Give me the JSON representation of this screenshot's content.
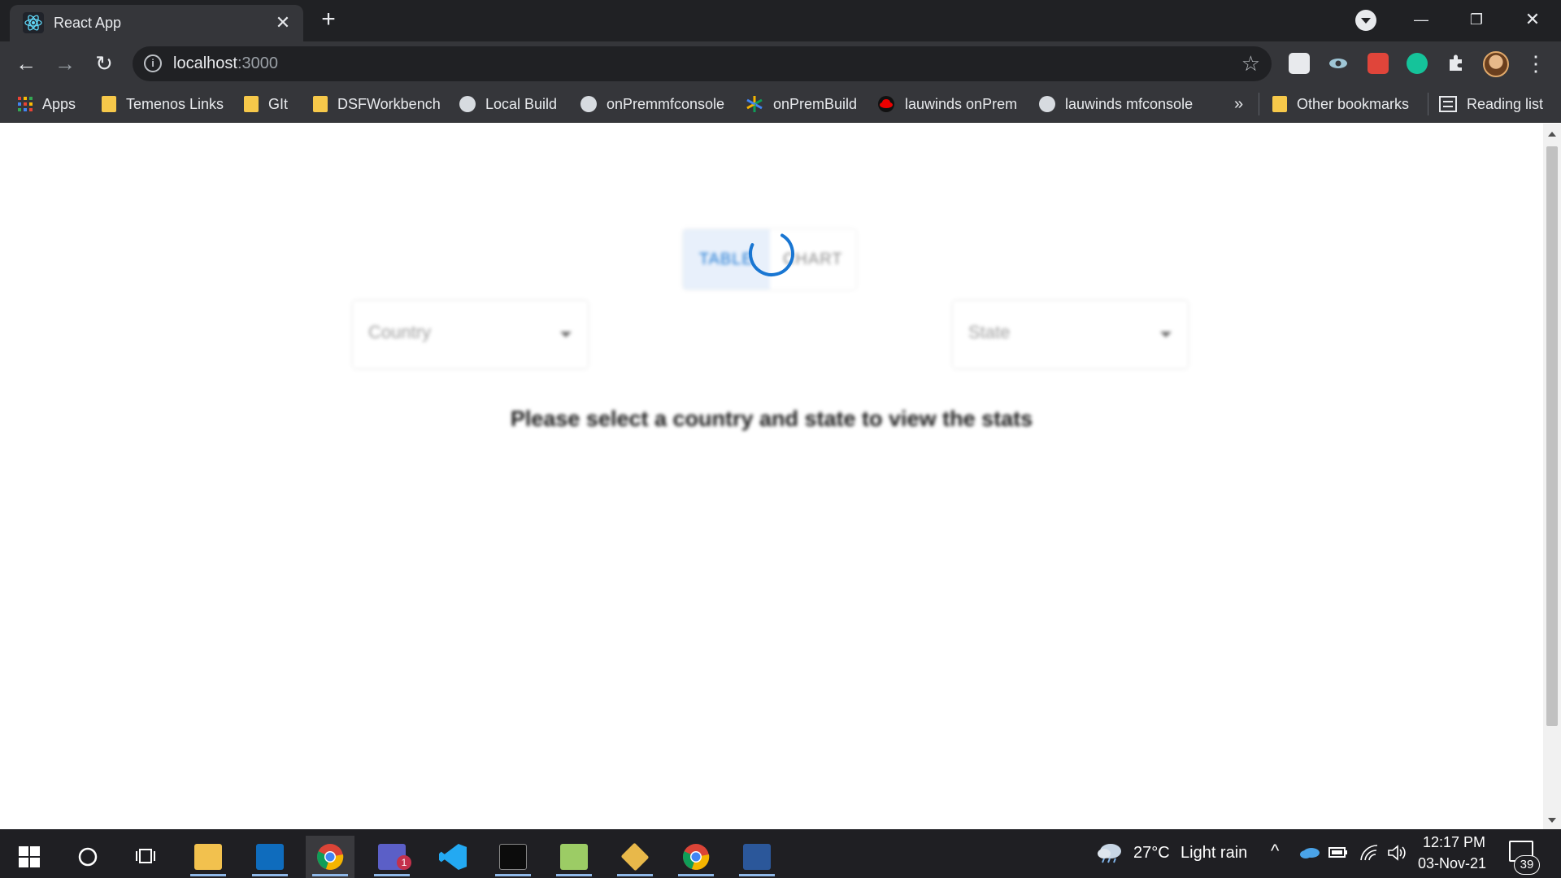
{
  "browser": {
    "tab": {
      "title": "React App"
    },
    "address": {
      "host": "localhost",
      "port": ":3000"
    },
    "bookmarks": [
      {
        "label": "Apps",
        "icon": "apps-grid-icon"
      },
      {
        "label": "Temenos Links",
        "icon": "folder-icon"
      },
      {
        "label": "GIt",
        "icon": "folder-icon"
      },
      {
        "label": "DSFWorkbench",
        "icon": "folder-icon"
      },
      {
        "label": "Local Build",
        "icon": "globe-icon"
      },
      {
        "label": "onPremmfconsole",
        "icon": "globe-icon"
      },
      {
        "label": "onPremBuild",
        "icon": "pinwheel-icon"
      },
      {
        "label": "lauwinds onPrem",
        "icon": "redhat-icon"
      },
      {
        "label": "lauwinds mfconsole",
        "icon": "globe-icon"
      }
    ],
    "bookmarks_overflow": "»",
    "other_bookmarks": "Other bookmarks",
    "reading_list": "Reading list"
  },
  "app": {
    "toggle": {
      "table_label": "TABLE",
      "chart_label": "CHART"
    },
    "country_select": {
      "placeholder": "Country"
    },
    "state_select": {
      "placeholder": "State"
    },
    "prompt": "Please select a country and state to view the stats",
    "loading": true,
    "accent_color": "#1976d2"
  },
  "taskbar": {
    "weather": {
      "temp": "27°C",
      "condition": "Light rain"
    },
    "clock": {
      "time": "12:17 PM",
      "date": "03-Nov-21"
    },
    "notifications": "39",
    "teams_badge": "1"
  }
}
